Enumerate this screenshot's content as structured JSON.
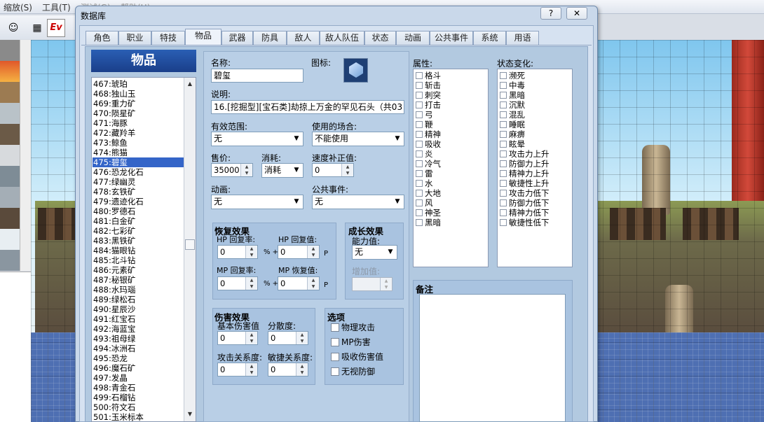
{
  "bg_menu": [
    "缩放(S)",
    "工具(T)",
    "测试(G)",
    "帮助(H)"
  ],
  "bg_toolbar": {
    "ev_label": "Ev"
  },
  "dialog": {
    "title": "数据库",
    "help_btn": "?",
    "close_btn": "✕"
  },
  "tabs": [
    "角色",
    "职业",
    "特技",
    "物品",
    "武器",
    "防具",
    "敌人",
    "敌人队伍",
    "状态",
    "动画",
    "公共事件",
    "系统",
    "用语"
  ],
  "active_tab": "物品",
  "list": {
    "header": "物品",
    "items": [
      "467:琥珀",
      "468:独山玉",
      "469:重力矿",
      "470:陨星矿",
      "471:海豚",
      "472:藏羚羊",
      "473:鲸鱼",
      "474:熊猫",
      "475:碧玺",
      "476:恐龙化石",
      "477:绿幽灵",
      "478:玄铁矿",
      "479:遗迹化石",
      "480:罗德石",
      "481:白金矿",
      "482:七彩矿",
      "483:黑铁矿",
      "484:猫眼钻",
      "485:北斗钻",
      "486:元素矿",
      "487:秘银矿",
      "488:水玛瑙",
      "489:绿松石",
      "490:星辰沙",
      "491:红宝石",
      "492:海蓝宝",
      "493:祖母绿",
      "494:冰洲石",
      "495:恐龙",
      "496:魔石矿",
      "497:发晶",
      "498:青金石",
      "499:石榴钻",
      "500:符文石",
      "501:玉米标本"
    ],
    "selected_index": 8
  },
  "form": {
    "name_label": "名称:",
    "name_value": "碧玺",
    "icon_label": "图标:",
    "desc_label": "说明:",
    "desc_value": "16.[挖掘型][宝石类]劫掠上万金的罕见石头（共03",
    "scope_label": "有效范围:",
    "scope_value": "无",
    "occasion_label": "使用的场合:",
    "occasion_value": "不能使用",
    "price_label": "售价:",
    "price_value": "35000",
    "consume_label": "消耗:",
    "consume_value": "消耗",
    "speed_label": "速度补正值:",
    "speed_value": "0",
    "anim_label": "动画:",
    "anim_value": "无",
    "common_event_label": "公共事件:",
    "common_event_value": "无"
  },
  "recovery": {
    "title": "恢复效果",
    "hp_rate_label": "HP 回复率:",
    "hp_rate": "0",
    "hp_value_label": "HP 回复值:",
    "hp_value": "0",
    "mp_rate_label": "MP 回复率:",
    "mp_rate": "0",
    "mp_value_label": "MP 恢复值:",
    "mp_value": "0",
    "pct_plus": "% +",
    "p": "P"
  },
  "growth": {
    "title": "成长效果",
    "param_label": "能力值:",
    "param_value": "无",
    "add_label": "增加值:"
  },
  "damage": {
    "title": "伤害效果",
    "base_label": "基本伤害值",
    "base_value": "0",
    "variance_label": "分散度:",
    "variance_value": "0",
    "atk_label": "攻击关系度:",
    "atk_value": "0",
    "agi_label": "敏捷关系度:",
    "agi_value": "0"
  },
  "options": {
    "title": "选项",
    "items": [
      "物理攻击",
      "MP伤害",
      "吸收伤害值",
      "无视防御"
    ]
  },
  "attributes": {
    "label": "属性:",
    "items": [
      "格斗",
      "斩击",
      "刺突",
      "打击",
      "弓",
      "鞭",
      "精神",
      "吸收",
      "炎",
      "冷气",
      "雷",
      "水",
      "大地",
      "风",
      "神圣",
      "黑暗"
    ]
  },
  "states": {
    "label": "状态变化:",
    "items": [
      "濒死",
      "中毒",
      "黑暗",
      "沉默",
      "混乱",
      "睡眠",
      "麻痹",
      "眩晕",
      "攻击力上升",
      "防御力上升",
      "精神力上升",
      "敏捷性上升",
      "攻击力低下",
      "防御力低下",
      "精神力低下",
      "敏捷性低下"
    ]
  },
  "note": {
    "label": "备注"
  }
}
